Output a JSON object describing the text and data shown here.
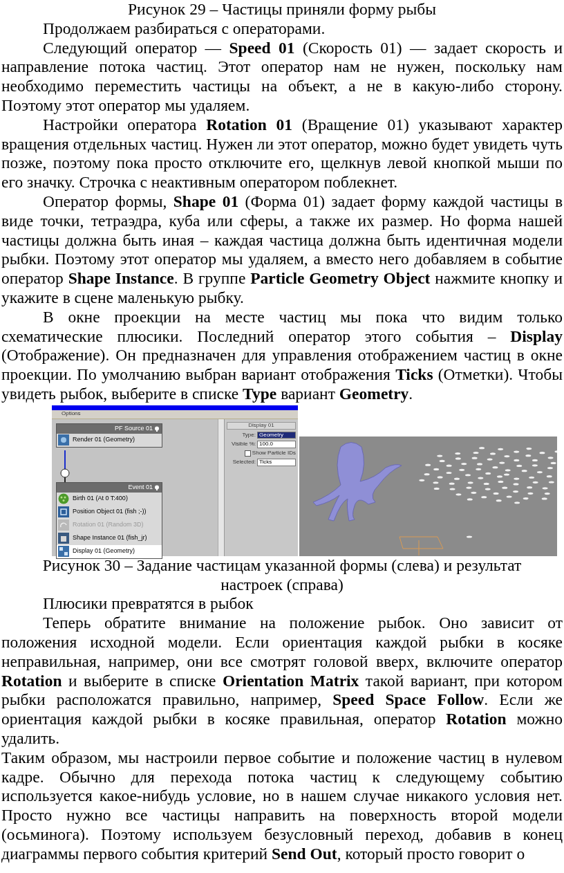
{
  "blocks": [
    {
      "kind": "caption",
      "text": "Рисунок 29 – Частицы приняли форму рыбы"
    },
    {
      "kind": "paragraph",
      "text": "Продолжаем разбираться с операторами."
    },
    {
      "kind": "paragraph",
      "text": "Следующий оператор — **Speed 01** (Скорость 01) — задает скорость и направление потока частиц. Этот оператор нам не нужен, поскольку нам необходимо переместить частицы на объект, а не в какую-либо сторону. Поэтому этот оператор мы удаляем."
    },
    {
      "kind": "paragraph",
      "text": "Настройки оператора **Rotation 01** (Вращение 01) указывают характер вращения отдельных частиц. Нужен ли этот оператор, можно будет увидеть чуть позже, поэтому пока просто отключите его, щелкнув левой кнопкой мыши по его значку. Строчка с неактивным оператором поблекнет."
    },
    {
      "kind": "paragraph",
      "text": "Оператор формы, **Shape 01** (Форма 01) задает форму каждой частицы в виде точки, тетраэдра, куба или сферы, а также их размер. Но форма нашей частицы должна быть иная – каждая частица должна быть идентичная модели рыбки. Поэтому этот оператор мы удаляем, а вместо него добавляем в событие оператор **Shape Instance**. В группе **Particle Geometry Object** нажмите кнопку и укажите в сцене маленькую рыбку."
    },
    {
      "kind": "paragraph",
      "text": "В окне проекции на месте частиц мы пока что видим только схематические плюсики. Последний оператор этого события – **Display** (Отображение). Он предназначен для управления отображением частиц в окне проекции. По умолчанию выбран вариант отображения **Ticks** (Отметки). Чтобы увидеть рыбок, выберите в списке **Type** вариант **Geometry**."
    },
    {
      "kind": "figure"
    },
    {
      "kind": "caption",
      "text": "Рисунок 30 – Задание частицам указанной формы (слева) и результат настроек (справа)"
    },
    {
      "kind": "paragraph",
      "text": "Плюсики превратятся в рыбок"
    },
    {
      "kind": "paragraph",
      "text": "Теперь обратите внимание на положение рыбок. Оно зависит от положения исходной модели. Если ориентация каждой рыбки в косяке неправильная, например, они все смотрят головой вверх, включите оператор **Rotation** и выберите в списке **Orientation Matrix** такой вариант, при котором рыбки расположатся правильно, например, **Speed Space Follow**. Если же ориентация каждой рыбки в косяке правильная, оператор **Rotation** можно удалить."
    },
    {
      "kind": "plain",
      "text": "Таким образом, мы настроили первое событие и положение частиц в нулевом кадре. Обычно для перехода потока частиц к следующему событию используется какое-нибудь условие, но в нашем случае никакого условия нет. Просто нужно все частицы направить на поверхность второй модели (осьминога). Поэтому используем безусловный переход, добавив в конец диаграммы первого события критерий **Send Out**, который просто говорит о"
    }
  ],
  "figure": {
    "screenshot": {
      "menu": [
        "Options"
      ],
      "source_node": {
        "title": "PF Source 01",
        "operators": [
          {
            "label": "Render 01 (Geometry)",
            "disabled": false,
            "selected": false
          }
        ]
      },
      "event_node": {
        "title": "Event 01",
        "operators": [
          {
            "label": "Birth 01 (At 0 T:400)",
            "disabled": false,
            "selected": false
          },
          {
            "label": "Position Object 01 (fish ;-))",
            "disabled": false,
            "selected": false
          },
          {
            "label": "Rotation 01 (Random 3D)",
            "disabled": true,
            "selected": false
          },
          {
            "label": "Shape Instance 01 (fish_jr)",
            "disabled": false,
            "selected": false
          },
          {
            "label": "Display 01 (Geometry)",
            "disabled": false,
            "selected": true
          }
        ]
      },
      "panel": {
        "title": "Display 01",
        "type_label": "Type:",
        "type_value": "Geometry",
        "visible_label": "Visible %:",
        "visible_value": "100.0",
        "show_ids_label": "Show Particle IDs",
        "show_ids_checked": false,
        "selected_label": "Selected:",
        "selected_value": "Ticks"
      }
    }
  }
}
